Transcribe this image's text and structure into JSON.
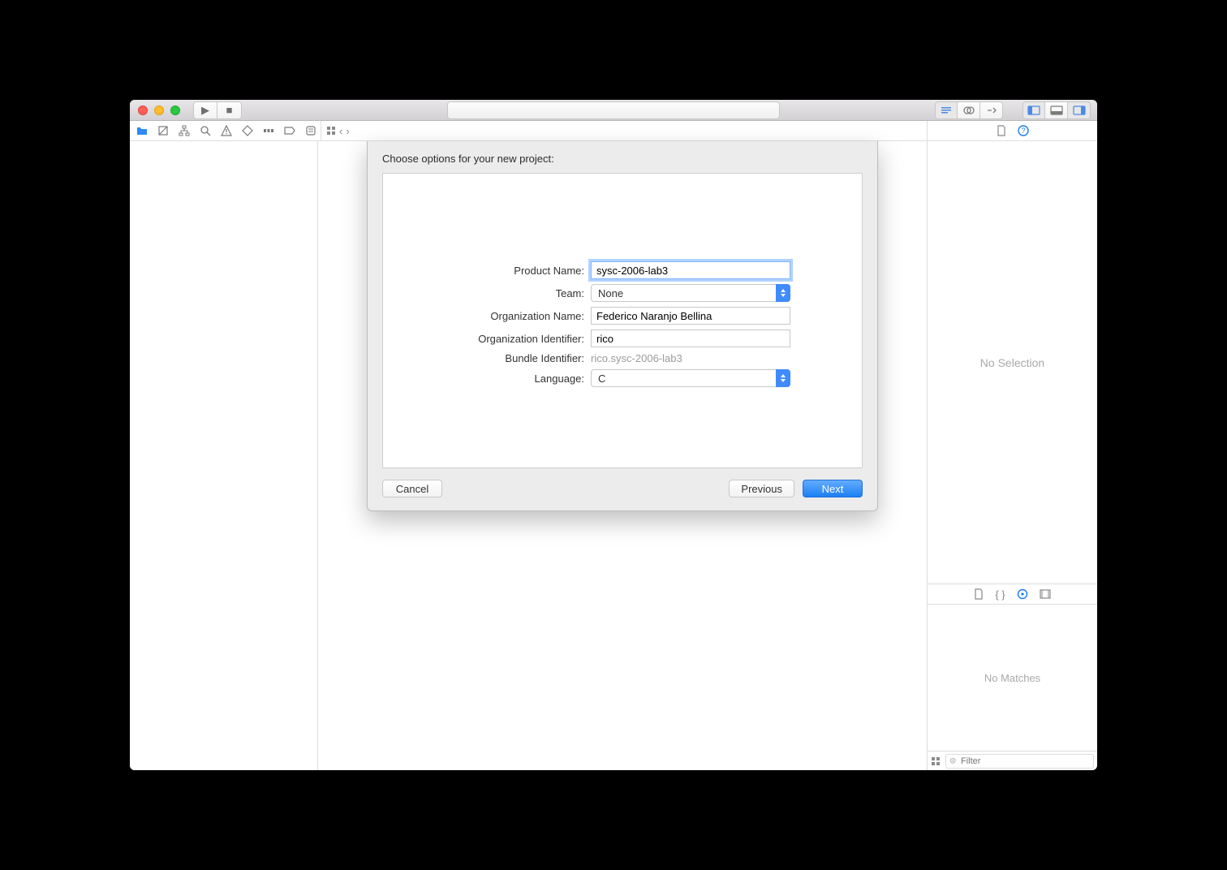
{
  "sheet": {
    "title": "Choose options for your new project:",
    "product_name_label": "Product Name:",
    "product_name_value": "sysc-2006-lab3",
    "team_label": "Team:",
    "team_value": "None",
    "org_name_label": "Organization Name:",
    "org_name_value": "Federico Naranjo Bellina",
    "org_id_label": "Organization Identifier:",
    "org_id_value": "rico",
    "bundle_id_label": "Bundle Identifier:",
    "bundle_id_value": "rico.sysc-2006-lab3",
    "language_label": "Language:",
    "language_value": "C",
    "cancel": "Cancel",
    "previous": "Previous",
    "next": "Next"
  },
  "inspector": {
    "no_selection": "No Selection",
    "no_matches": "No Matches",
    "filter_placeholder": "Filter"
  }
}
